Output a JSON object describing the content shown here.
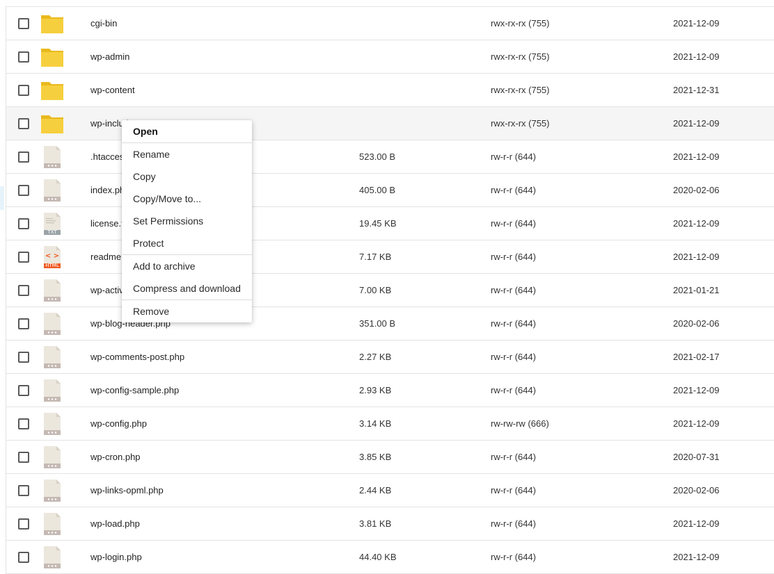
{
  "files": [
    {
      "name": "cgi-bin",
      "type": "folder",
      "size": "",
      "perm": "rwx-rx-rx (755)",
      "date": "2021-12-09"
    },
    {
      "name": "wp-admin",
      "type": "folder",
      "size": "",
      "perm": "rwx-rx-rx (755)",
      "date": "2021-12-09"
    },
    {
      "name": "wp-content",
      "type": "folder",
      "size": "",
      "perm": "rwx-rx-rx (755)",
      "date": "2021-12-31"
    },
    {
      "name": "wp-includes",
      "type": "folder",
      "size": "",
      "perm": "rwx-rx-rx (755)",
      "date": "2021-12-09"
    },
    {
      "name": ".htaccess",
      "type": "file",
      "size": "523.00 B",
      "perm": "rw-r-r (644)",
      "date": "2021-12-09"
    },
    {
      "name": "index.php",
      "type": "file",
      "size": "405.00 B",
      "perm": "rw-r-r (644)",
      "date": "2020-02-06"
    },
    {
      "name": "license.txt",
      "type": "txt",
      "size": "19.45 KB",
      "perm": "rw-r-r (644)",
      "date": "2021-12-09"
    },
    {
      "name": "readme.html",
      "type": "html",
      "size": "7.17 KB",
      "perm": "rw-r-r (644)",
      "date": "2021-12-09"
    },
    {
      "name": "wp-activate.php",
      "type": "file",
      "size": "7.00 KB",
      "perm": "rw-r-r (644)",
      "date": "2021-01-21"
    },
    {
      "name": "wp-blog-header.php",
      "type": "file",
      "size": "351.00 B",
      "perm": "rw-r-r (644)",
      "date": "2020-02-06"
    },
    {
      "name": "wp-comments-post.php",
      "type": "file",
      "size": "2.27 KB",
      "perm": "rw-r-r (644)",
      "date": "2021-02-17"
    },
    {
      "name": "wp-config-sample.php",
      "type": "file",
      "size": "2.93 KB",
      "perm": "rw-r-r (644)",
      "date": "2021-12-09"
    },
    {
      "name": "wp-config.php",
      "type": "file",
      "size": "3.14 KB",
      "perm": "rw-rw-rw (666)",
      "date": "2021-12-09"
    },
    {
      "name": "wp-cron.php",
      "type": "file",
      "size": "3.85 KB",
      "perm": "rw-r-r (644)",
      "date": "2020-07-31"
    },
    {
      "name": "wp-links-opml.php",
      "type": "file",
      "size": "2.44 KB",
      "perm": "rw-r-r (644)",
      "date": "2020-02-06"
    },
    {
      "name": "wp-load.php",
      "type": "file",
      "size": "3.81 KB",
      "perm": "rw-r-r (644)",
      "date": "2021-12-09"
    },
    {
      "name": "wp-login.php",
      "type": "file",
      "size": "44.40 KB",
      "perm": "rw-r-r (644)",
      "date": "2021-12-09"
    }
  ],
  "hovered_row_index": 3,
  "icon_labels": {
    "txt": "TXT",
    "html": "HTML",
    "html_glyph": "< >"
  },
  "context_menu": {
    "open": "Open",
    "rename": "Rename",
    "copy": "Copy",
    "copy_move": "Copy/Move to...",
    "set_permissions": "Set Permissions",
    "protect": "Protect",
    "add_to_archive": "Add to archive",
    "compress_download": "Compress and download",
    "remove": "Remove"
  },
  "colors": {
    "folder": "#f6cf3e",
    "folder_tab": "#e9b91e",
    "file_body": "#ece7dd",
    "file_band": "#c5b9b4",
    "txt_band": "#9aa3a8",
    "html_band": "#ee5a24"
  }
}
